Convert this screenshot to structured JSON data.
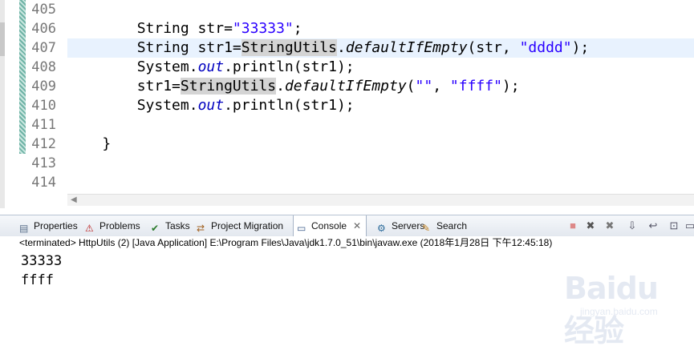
{
  "editor": {
    "line_numbers": [
      "405",
      "406",
      "407",
      "408",
      "409",
      "410",
      "411",
      "412",
      "413",
      "414"
    ],
    "lines": [
      {
        "num": "405",
        "segments": []
      },
      {
        "num": "406",
        "segments": [
          {
            "t": "        String str=",
            "c": ""
          },
          {
            "t": "\"33333\"",
            "c": "str"
          },
          {
            "t": ";",
            "c": ""
          }
        ]
      },
      {
        "num": "407",
        "highlight": true,
        "segments": [
          {
            "t": "        String str1=",
            "c": ""
          },
          {
            "t": "StringUtils",
            "c": "occ"
          },
          {
            "t": ".",
            "c": ""
          },
          {
            "t": "defaultIfEmpty",
            "c": "ital"
          },
          {
            "t": "(str, ",
            "c": ""
          },
          {
            "t": "\"dddd\"",
            "c": "str"
          },
          {
            "t": ");",
            "c": ""
          }
        ]
      },
      {
        "num": "408",
        "segments": [
          {
            "t": "        System.",
            "c": ""
          },
          {
            "t": "out",
            "c": "fld"
          },
          {
            "t": ".println(str1);",
            "c": ""
          }
        ]
      },
      {
        "num": "409",
        "segments": [
          {
            "t": "        str1=",
            "c": ""
          },
          {
            "t": "StringUtils",
            "c": "occ"
          },
          {
            "t": ".",
            "c": ""
          },
          {
            "t": "defaultIfEmpty",
            "c": "ital"
          },
          {
            "t": "(",
            "c": ""
          },
          {
            "t": "\"\"",
            "c": "str"
          },
          {
            "t": ", ",
            "c": ""
          },
          {
            "t": "\"ffff\"",
            "c": "str"
          },
          {
            "t": ");",
            "c": ""
          }
        ]
      },
      {
        "num": "410",
        "segments": [
          {
            "t": "        System.",
            "c": ""
          },
          {
            "t": "out",
            "c": "fld"
          },
          {
            "t": ".println(str1);",
            "c": ""
          }
        ]
      },
      {
        "num": "411",
        "segments": []
      },
      {
        "num": "412",
        "segments": [
          {
            "t": "    }",
            "c": ""
          }
        ]
      },
      {
        "num": "413",
        "segments": []
      },
      {
        "num": "414",
        "segments": []
      }
    ]
  },
  "views": {
    "tabs": [
      {
        "label": "Properties",
        "icon": "properties-icon"
      },
      {
        "label": "Problems",
        "icon": "problems-icon"
      },
      {
        "label": "Tasks",
        "icon": "tasks-icon"
      },
      {
        "label": "Project Migration",
        "icon": "project-migration-icon"
      },
      {
        "label": "Console",
        "icon": "console-icon",
        "active": true
      },
      {
        "label": "Servers",
        "icon": "servers-icon"
      },
      {
        "label": "Search",
        "icon": "search-icon"
      }
    ],
    "toolbar_icons": [
      "terminate-icon",
      "remove-launch-icon",
      "remove-all-terminated-icon",
      "scroll-lock-icon",
      "word-wrap-icon",
      "pin-console-icon",
      "display-selected-console-icon"
    ]
  },
  "console": {
    "status": "<terminated> HttpUtils (2) [Java Application] E:\\Program Files\\Java\\jdk1.7.0_51\\bin\\javaw.exe (2018年1月28日 下午12:45:18)",
    "output": [
      "33333",
      "ffff"
    ]
  },
  "watermark": {
    "brand": "Baidu经验",
    "url": "jingyan.baidu.com"
  },
  "colors": {
    "string": "#2a00ff",
    "field": "#0000c0",
    "current_line": "#e8f2fe",
    "occurrence": "#d4d4d4"
  }
}
